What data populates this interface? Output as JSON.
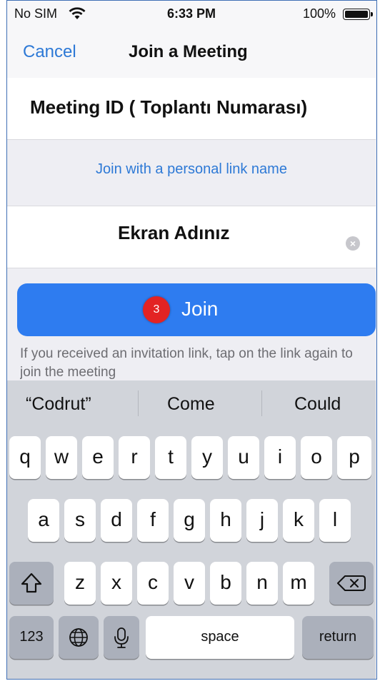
{
  "status_bar": {
    "carrier": "No SIM",
    "time": "6:33 PM",
    "battery": "100%"
  },
  "nav": {
    "cancel": "Cancel",
    "title": "Join a Meeting"
  },
  "form": {
    "meeting_id": "Meeting ID ( Toplantı Numarası)",
    "personal_link": "Join with a personal link name",
    "screen_name": "Ekran Adınız",
    "clear_icon": "clear-x-icon"
  },
  "join": {
    "badge": "3",
    "label": "Join"
  },
  "hint": "If you received an invitation link, tap on the link again to join the meeting",
  "keyboard": {
    "suggestions": [
      "“Codrut”",
      "Come",
      "Could"
    ],
    "row1": [
      "q",
      "w",
      "e",
      "r",
      "t",
      "y",
      "u",
      "i",
      "o",
      "p"
    ],
    "row2": [
      "a",
      "s",
      "d",
      "f",
      "g",
      "h",
      "j",
      "k",
      "l"
    ],
    "row3": [
      "z",
      "x",
      "c",
      "v",
      "b",
      "n",
      "m"
    ],
    "numbers": "123",
    "space": "space",
    "return": "return"
  }
}
